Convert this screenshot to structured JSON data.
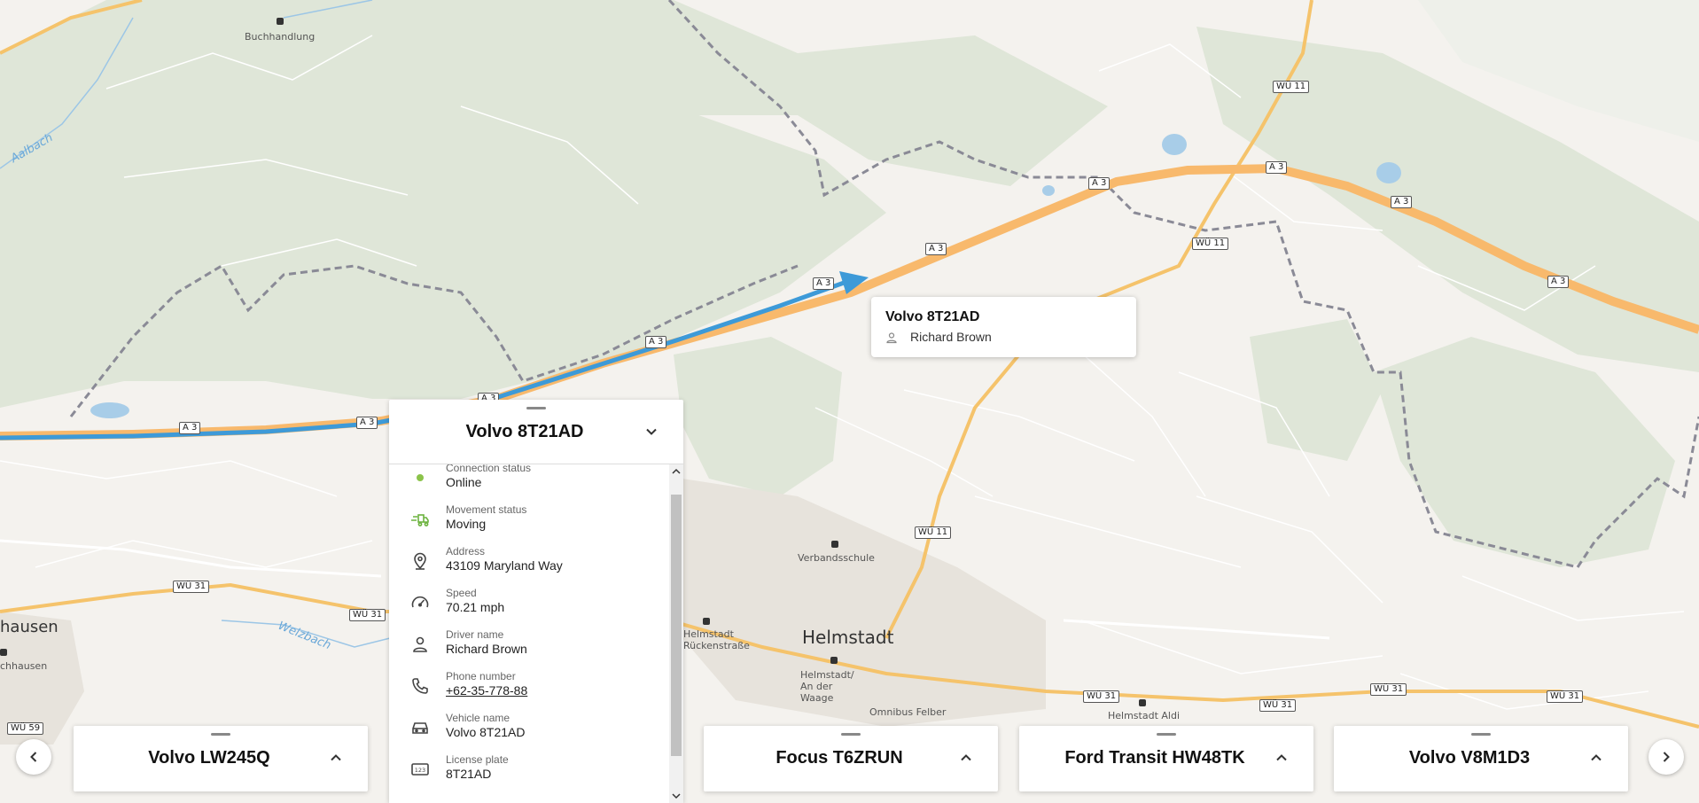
{
  "map": {
    "place_labels": [
      "Buchhandlung",
      "Aalbach",
      "hausen",
      "chhausen",
      "Welzbach",
      "Verbandsschule",
      "Helmstadt",
      "Helmstadt Rückenstraße",
      "Helmstadt/ An der Waage",
      "Omnibus Felber",
      "Helmstadt Aldi"
    ],
    "road_shields": [
      "A 3",
      "WÜ 11",
      "WÜ 31",
      "WÜ 59"
    ]
  },
  "tooltip": {
    "vehicle": "Volvo 8T21AD",
    "driver": "Richard Brown"
  },
  "panel": {
    "title": "Volvo 8T21AD",
    "status_color": "#8bc34a",
    "rows": [
      {
        "label": "Connection status",
        "value": "Online",
        "icon": "status-dot-icon"
      },
      {
        "label": "Movement status",
        "value": "Moving",
        "icon": "moving-truck-icon"
      },
      {
        "label": "Address",
        "value": "43109 Maryland Way",
        "icon": "location-pin-icon"
      },
      {
        "label": "Speed",
        "value": "70.21 mph",
        "icon": "speedometer-icon"
      },
      {
        "label": "Driver name",
        "value": "Richard Brown",
        "icon": "person-icon"
      },
      {
        "label": "Phone number",
        "value": "+62-35-778-88",
        "icon": "phone-icon"
      },
      {
        "label": "Vehicle name",
        "value": "Volvo 8T21AD",
        "icon": "car-icon"
      },
      {
        "label": "License plate",
        "value": "8T21AD",
        "icon": "license-plate-icon"
      }
    ]
  },
  "cards": [
    {
      "title": "Volvo LW245Q"
    },
    {
      "title": "Focus T6ZRUN"
    },
    {
      "title": "Ford Transit HW48TK"
    },
    {
      "title": "Volvo V8M1D3"
    }
  ],
  "colors": {
    "route": "#3d9ad8",
    "highway": "#f8b96c",
    "secondary_road": "#f5c36b",
    "forest": "#dfe6d8",
    "background": "#f4f2ee"
  }
}
